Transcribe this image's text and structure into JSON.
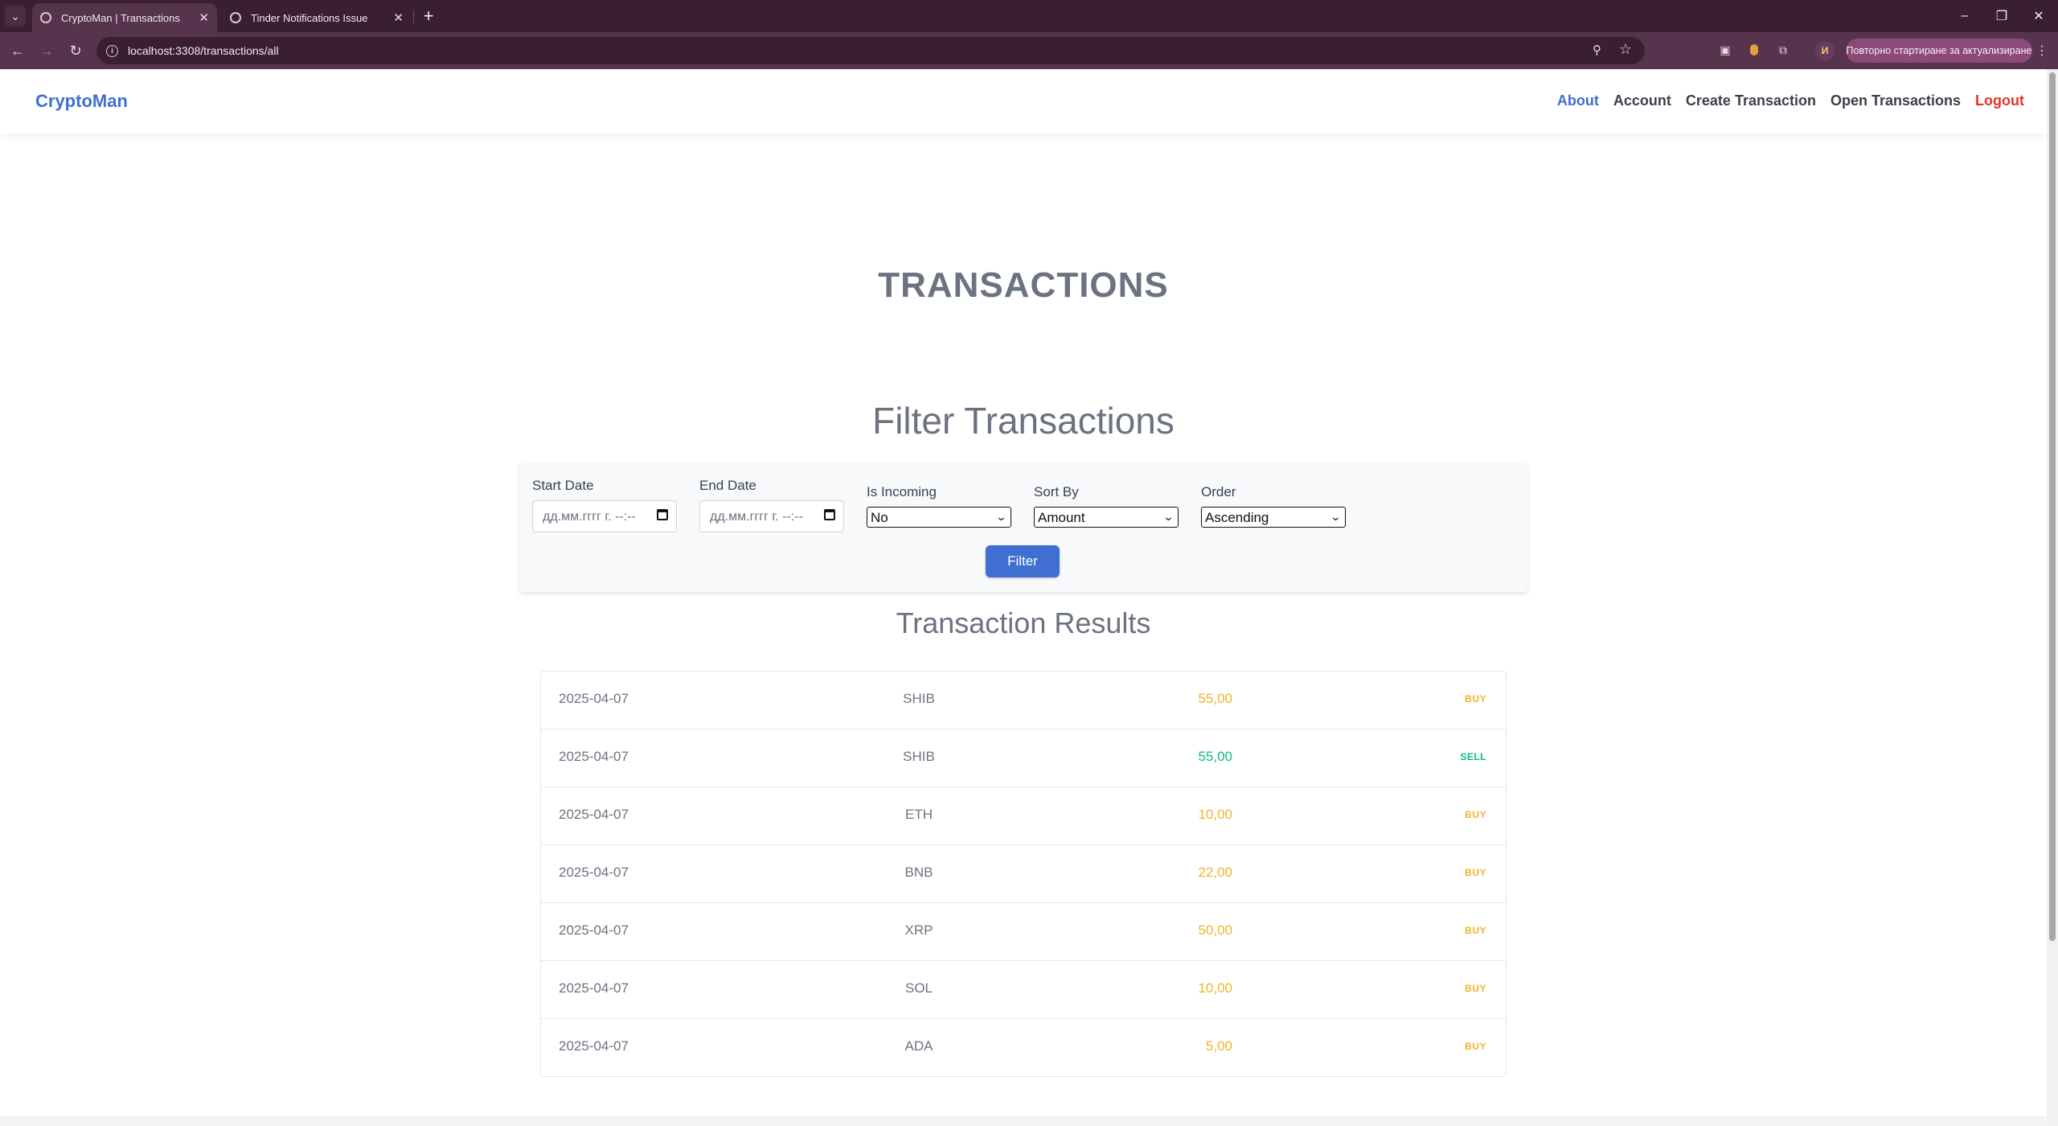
{
  "browser": {
    "tabs": [
      {
        "title": "CryptoMan | Transactions",
        "active": true
      },
      {
        "title": "Tinder Notifications Issue",
        "active": false
      }
    ],
    "url": "localhost:3308/transactions/all",
    "profile_initial": "И",
    "update_label": "Повторно стартиране за актуализиране",
    "colors": {
      "frame": "#3a1f33",
      "toolbar": "#57344d",
      "update_pill": "#8b4a78"
    }
  },
  "site": {
    "brand": "CryptoMan",
    "nav": {
      "about": "About",
      "account": "Account",
      "create": "Create Transaction",
      "open": "Open Transactions",
      "logout": "Logout"
    },
    "colors": {
      "accent": "#3f6fd1",
      "logout": "#e2342b",
      "buy": "#f0b429",
      "sell": "#10b981"
    }
  },
  "main": {
    "title": "TRANSACTIONS",
    "filter": {
      "heading": "Filter Transactions",
      "start_date": {
        "label": "Start Date",
        "value": "дд.мм.гггг г. --:--"
      },
      "end_date": {
        "label": "End Date",
        "value": "дд.мм.гггг г. --:--"
      },
      "is_incoming": {
        "label": "Is Incoming",
        "value": "No"
      },
      "sort_by": {
        "label": "Sort By",
        "value": "Amount"
      },
      "order": {
        "label": "Order",
        "value": "Ascending"
      },
      "button": "Filter"
    },
    "results": {
      "heading": "Transaction Results",
      "rows": [
        {
          "date": "2025-04-07",
          "coin": "SHIB",
          "amount": "55,00",
          "type": "BUY"
        },
        {
          "date": "2025-04-07",
          "coin": "SHIB",
          "amount": "55,00",
          "type": "SELL"
        },
        {
          "date": "2025-04-07",
          "coin": "ETH",
          "amount": "10,00",
          "type": "BUY"
        },
        {
          "date": "2025-04-07",
          "coin": "BNB",
          "amount": "22,00",
          "type": "BUY"
        },
        {
          "date": "2025-04-07",
          "coin": "XRP",
          "amount": "50,00",
          "type": "BUY"
        },
        {
          "date": "2025-04-07",
          "coin": "SOL",
          "amount": "10,00",
          "type": "BUY"
        },
        {
          "date": "2025-04-07",
          "coin": "ADA",
          "amount": "5,00",
          "type": "BUY"
        }
      ]
    }
  }
}
